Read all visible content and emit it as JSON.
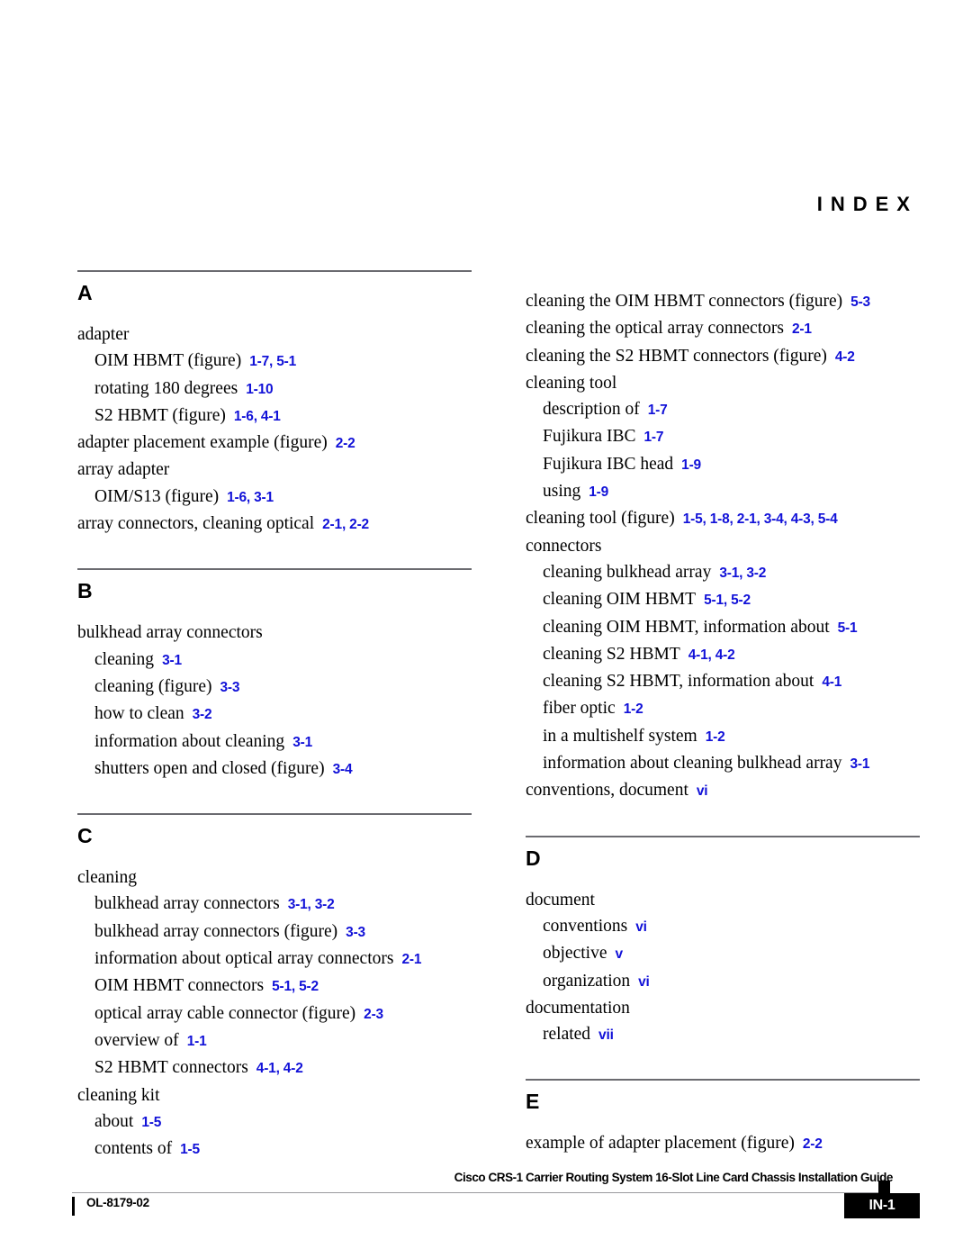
{
  "header": {
    "title": "INDEX"
  },
  "colors": {
    "page_reference_blue": "#1111d8",
    "rule_gray": "#6b6b70",
    "text_black": "#000000"
  },
  "columns": [
    {
      "name": "left-column",
      "sections": [
        {
          "letter": "A",
          "entries": [
            {
              "level": 1,
              "text": "adapter",
              "refs": ""
            },
            {
              "level": 2,
              "text": "OIM HBMT (figure)",
              "refs": "1-7, 5-1"
            },
            {
              "level": 2,
              "text": "rotating 180 degrees",
              "refs": "1-10"
            },
            {
              "level": 2,
              "text": "S2 HBMT (figure)",
              "refs": "1-6, 4-1"
            },
            {
              "level": 1,
              "text": "adapter placement example (figure)",
              "refs": "2-2"
            },
            {
              "level": 1,
              "text": "array adapter",
              "refs": ""
            },
            {
              "level": 2,
              "text": "OIM/S13 (figure)",
              "refs": "1-6, 3-1"
            },
            {
              "level": 1,
              "text": "array connectors, cleaning optical",
              "refs": "2-1, 2-2"
            }
          ]
        },
        {
          "letter": "B",
          "entries": [
            {
              "level": 1,
              "text": "bulkhead array connectors",
              "refs": ""
            },
            {
              "level": 2,
              "text": "cleaning",
              "refs": "3-1"
            },
            {
              "level": 2,
              "text": "cleaning (figure)",
              "refs": "3-3"
            },
            {
              "level": 2,
              "text": "how to clean",
              "refs": "3-2"
            },
            {
              "level": 2,
              "text": "information about cleaning",
              "refs": "3-1"
            },
            {
              "level": 2,
              "text": "shutters open and closed (figure)",
              "refs": "3-4"
            }
          ]
        },
        {
          "letter": "C",
          "entries": [
            {
              "level": 1,
              "text": "cleaning",
              "refs": ""
            },
            {
              "level": 2,
              "text": "bulkhead array connectors",
              "refs": "3-1, 3-2"
            },
            {
              "level": 2,
              "text": "bulkhead array connectors (figure)",
              "refs": "3-3"
            },
            {
              "level": 2,
              "text": "information about optical array connectors",
              "refs": "2-1"
            },
            {
              "level": 2,
              "text": "OIM HBMT connectors",
              "refs": "5-1, 5-2"
            },
            {
              "level": 2,
              "text": "optical array cable connector (figure)",
              "refs": "2-3"
            },
            {
              "level": 2,
              "text": "overview of",
              "refs": "1-1"
            },
            {
              "level": 2,
              "text": "S2 HBMT connectors",
              "refs": "4-1, 4-2"
            },
            {
              "level": 1,
              "text": "cleaning kit",
              "refs": ""
            },
            {
              "level": 2,
              "text": "about",
              "refs": "1-5"
            },
            {
              "level": 2,
              "text": "contents of",
              "refs": "1-5"
            }
          ]
        }
      ]
    },
    {
      "name": "right-column",
      "sections": [
        {
          "letter": "",
          "entries": [
            {
              "level": 1,
              "text": "cleaning the OIM HBMT connectors (figure)",
              "refs": "5-3"
            },
            {
              "level": 1,
              "text": "cleaning the optical array connectors",
              "refs": "2-1"
            },
            {
              "level": 1,
              "text": "cleaning the S2 HBMT connectors (figure)",
              "refs": "4-2"
            },
            {
              "level": 1,
              "text": "cleaning tool",
              "refs": ""
            },
            {
              "level": 2,
              "text": "description of",
              "refs": "1-7"
            },
            {
              "level": 2,
              "text": "Fujikura IBC",
              "refs": "1-7"
            },
            {
              "level": 2,
              "text": "Fujikura IBC head",
              "refs": "1-9"
            },
            {
              "level": 2,
              "text": "using",
              "refs": "1-9"
            },
            {
              "level": 1,
              "text": "cleaning tool (figure)",
              "refs": "1-5, 1-8, 2-1, 3-4, 4-3, 5-4"
            },
            {
              "level": 1,
              "text": "connectors",
              "refs": ""
            },
            {
              "level": 2,
              "text": "cleaning bulkhead array",
              "refs": "3-1, 3-2"
            },
            {
              "level": 2,
              "text": "cleaning OIM HBMT",
              "refs": "5-1, 5-2"
            },
            {
              "level": 2,
              "text": "cleaning OIM HBMT, information about",
              "refs": "5-1"
            },
            {
              "level": 2,
              "text": "cleaning S2 HBMT",
              "refs": "4-1, 4-2"
            },
            {
              "level": 2,
              "text": "cleaning S2 HBMT, information about",
              "refs": "4-1"
            },
            {
              "level": 2,
              "text": "fiber optic",
              "refs": "1-2"
            },
            {
              "level": 2,
              "text": "in a multishelf system",
              "refs": "1-2"
            },
            {
              "level": 2,
              "text": "information about cleaning bulkhead array",
              "refs": "3-1"
            },
            {
              "level": 1,
              "text": "conventions, document",
              "refs": "vi"
            }
          ]
        },
        {
          "letter": "D",
          "entries": [
            {
              "level": 1,
              "text": "document",
              "refs": ""
            },
            {
              "level": 2,
              "text": "conventions",
              "refs": "vi"
            },
            {
              "level": 2,
              "text": "objective",
              "refs": "v"
            },
            {
              "level": 2,
              "text": "organization",
              "refs": "vi"
            },
            {
              "level": 1,
              "text": "documentation",
              "refs": ""
            },
            {
              "level": 2,
              "text": "related",
              "refs": "vii"
            }
          ]
        },
        {
          "letter": "E",
          "entries": [
            {
              "level": 1,
              "text": "example of adapter placement (figure)",
              "refs": "2-2"
            }
          ]
        }
      ]
    }
  ],
  "footer": {
    "title": "Cisco CRS-1 Carrier Routing System 16-Slot Line Card Chassis Installation Guide",
    "document_id": "OL-8179-02",
    "page_number": "IN-1"
  }
}
